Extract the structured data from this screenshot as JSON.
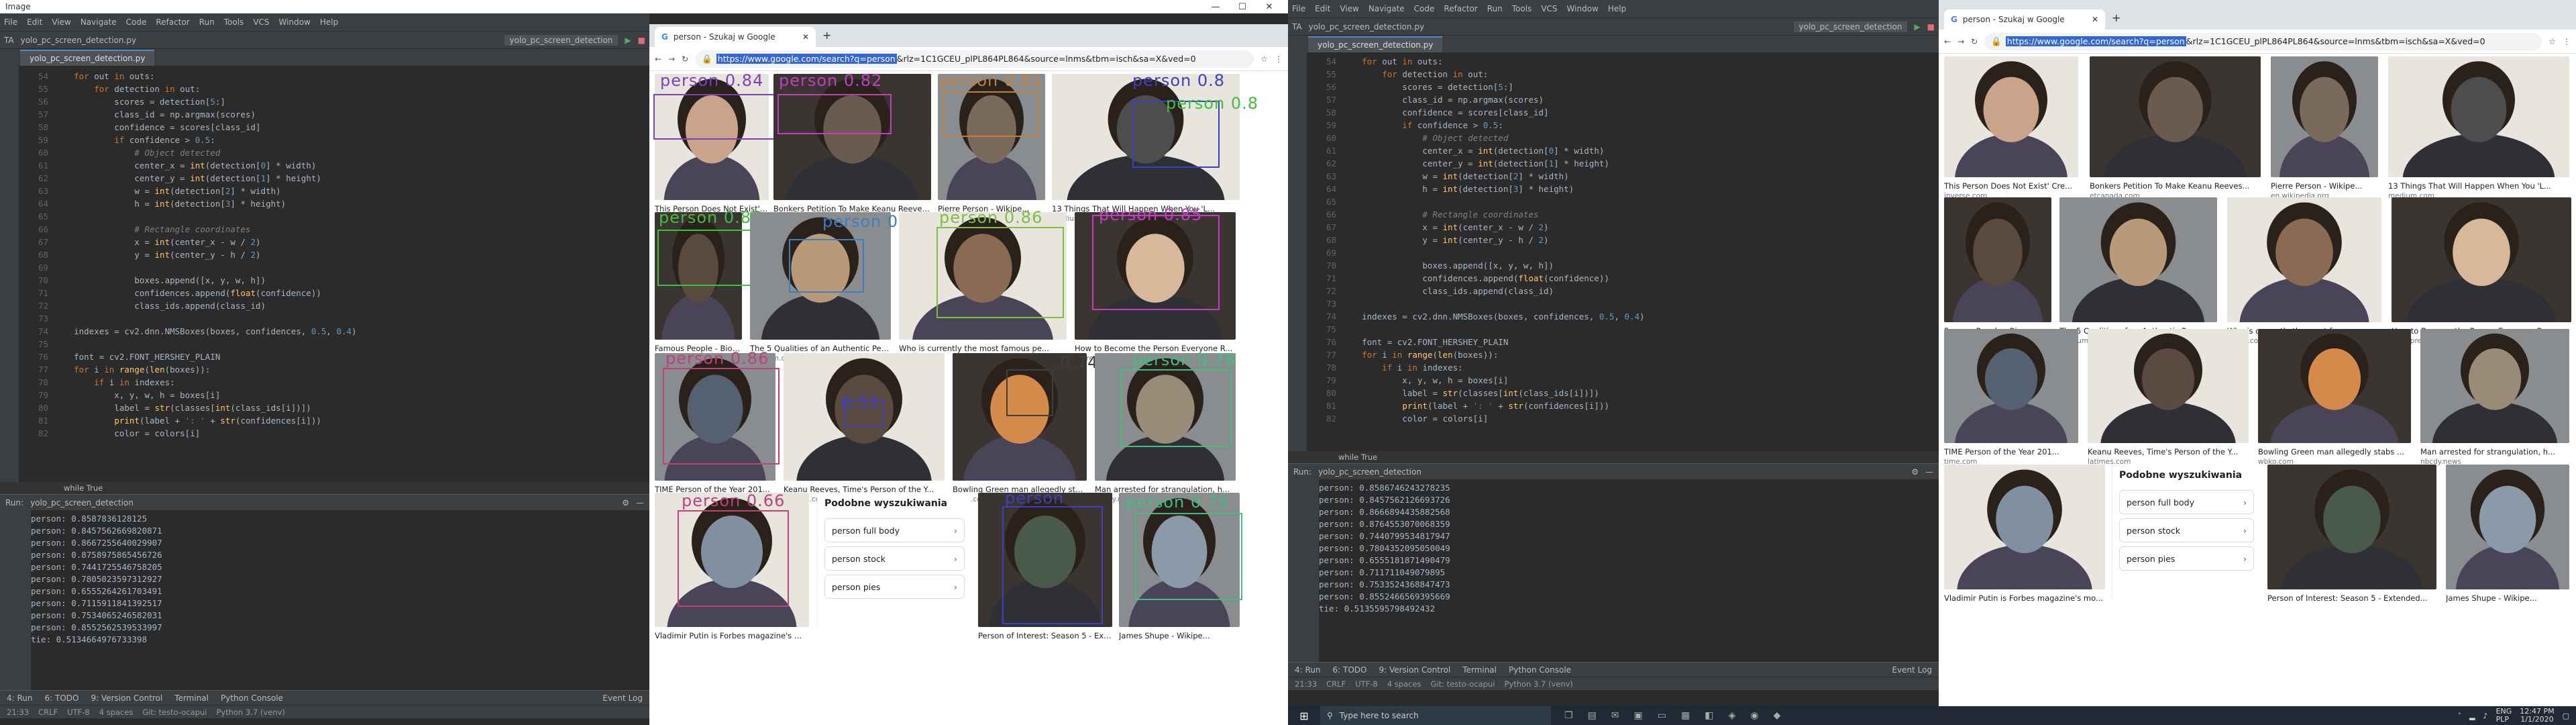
{
  "image_window": {
    "title": "Image",
    "controls": [
      "—",
      "☐",
      "✕"
    ]
  },
  "ide": {
    "menu": [
      "File",
      "Edit",
      "View",
      "Navigate",
      "Code",
      "Refactor",
      "Run",
      "Tools",
      "VCS",
      "Window",
      "Help"
    ],
    "project": "TA",
    "file": "yolo_pc_screen_detection.py",
    "run_config": "yolo_pc_screen_detection",
    "tab_label": "yolo_pc_screen_detection.py",
    "breadcrumb": "while True",
    "run_label": "Run:",
    "run_config_tab": "yolo_pc_screen_detection",
    "bottom_tabs": [
      "4: Run",
      "6: TODO",
      "9: Version Control",
      "Terminal",
      "Python Console"
    ],
    "event_log": "Event Log",
    "status": [
      "21:33",
      "CRLF",
      "UTF-8",
      "4 spaces",
      "Git: testo-ocapui",
      "Python 3.7 (venv)"
    ]
  },
  "code_left": [
    {
      "n": "54",
      "t": "    for out in outs:"
    },
    {
      "n": "55",
      "t": "        for detection in out:"
    },
    {
      "n": "56",
      "t": "            scores = detection[5:]"
    },
    {
      "n": "57",
      "t": "            class_id = np.argmax(scores)"
    },
    {
      "n": "58",
      "t": "            confidence = scores[class_id]"
    },
    {
      "n": "59",
      "t": "            if confidence > 0.5:"
    },
    {
      "n": "60",
      "t": "                # Object detected"
    },
    {
      "n": "61",
      "t": "                center_x = int(detection[0] * width)"
    },
    {
      "n": "62",
      "t": "                center_y = int(detection[1] * height)"
    },
    {
      "n": "63",
      "t": "                w = int(detection[2] * width)"
    },
    {
      "n": "64",
      "t": "                h = int(detection[3] * height)"
    },
    {
      "n": "65",
      "t": ""
    },
    {
      "n": "66",
      "t": "                # Rectangle coordinates"
    },
    {
      "n": "67",
      "t": "                x = int(center_x - w / 2)"
    },
    {
      "n": "68",
      "t": "                y = int(center_y - h / 2)"
    },
    {
      "n": "69",
      "t": ""
    },
    {
      "n": "70",
      "t": "                boxes.append([x, y, w, h])"
    },
    {
      "n": "71",
      "t": "                confidences.append(float(confidence))"
    },
    {
      "n": "72",
      "t": "                class_ids.append(class_id)"
    },
    {
      "n": "73",
      "t": ""
    },
    {
      "n": "74",
      "t": "    indexes = cv2.dnn.NMSBoxes(boxes, confidences, 0.5, 0.4)"
    },
    {
      "n": "75",
      "t": ""
    },
    {
      "n": "76",
      "t": "    font = cv2.FONT_HERSHEY_PLAIN"
    },
    {
      "n": "77",
      "t": "    for i in range(len(boxes)):"
    },
    {
      "n": "78",
      "t": "        if i in indexes:"
    },
    {
      "n": "79",
      "t": "            x, y, w, h = boxes[i]"
    },
    {
      "n": "80",
      "t": "            label = str(classes[int(class_ids[i])])"
    },
    {
      "n": "81",
      "t": "            print(label + ': ' + str(confidences[i]))"
    },
    {
      "n": "82",
      "t": "            color = colors[i]"
    }
  ],
  "code_right": [
    {
      "n": "54",
      "t": "    for out in outs:"
    },
    {
      "n": "55",
      "t": "        for detection in out:"
    },
    {
      "n": "56",
      "t": "            scores = detection[5:]"
    },
    {
      "n": "57",
      "t": "            class_id = np.argmax(scores)"
    },
    {
      "n": "58",
      "t": "            confidence = scores[class_id]"
    },
    {
      "n": "59",
      "t": "            if confidence > 0.5:"
    },
    {
      "n": "60",
      "t": "                # Object detected"
    },
    {
      "n": "61",
      "t": "                center_x = int(detection[0] * width)"
    },
    {
      "n": "62",
      "t": "                center_y = int(detection[1] * height)"
    },
    {
      "n": "63",
      "t": "                w = int(detection[2] * width)"
    },
    {
      "n": "64",
      "t": "                h = int(detection[3] * height)"
    },
    {
      "n": "65",
      "t": ""
    },
    {
      "n": "66",
      "t": "                # Rectangle coordinates"
    },
    {
      "n": "67",
      "t": "                x = int(center_x - w / 2)"
    },
    {
      "n": "68",
      "t": "                y = int(center_y - h / 2)"
    },
    {
      "n": "69",
      "t": ""
    },
    {
      "n": "70",
      "t": "                boxes.append([x, y, w, h])"
    },
    {
      "n": "71",
      "t": "                confidences.append(float(confidence))"
    },
    {
      "n": "72",
      "t": "                class_ids.append(class_id)"
    },
    {
      "n": "73",
      "t": ""
    },
    {
      "n": "74",
      "t": "    indexes = cv2.dnn.NMSBoxes(boxes, confidences, 0.5, 0.4)"
    },
    {
      "n": "75",
      "t": ""
    },
    {
      "n": "76",
      "t": "    font = cv2.FONT_HERSHEY_PLAIN"
    },
    {
      "n": "77",
      "t": "    for i in range(len(boxes)):"
    },
    {
      "n": "78",
      "t": "        if i in indexes:"
    },
    {
      "n": "79",
      "t": "            x, y, w, h = boxes[i]"
    },
    {
      "n": "80",
      "t": "            label = str(classes[int(class_ids[i])])"
    },
    {
      "n": "81",
      "t": "            print(label + ': ' + str(confidences[i]))"
    },
    {
      "n": "82",
      "t": "            color = colors[i]"
    }
  ],
  "console_left": [
    "person: 0.8587836128125",
    "person: 0.8457562669820871",
    "person: 0.8667255640029907",
    "person: 0.8758975865456726",
    "person: 0.7441725546758205",
    "person: 0.7805023597312927",
    "person: 0.6555264261703491",
    "person: 0.7115911841392517",
    "person: 0.7534065246582031",
    "person: 0.8552562539533997",
    "tie: 0.5134664976733398"
  ],
  "console_right": [
    "person: 0.8586746243278235",
    "person: 0.8457562126693726",
    "person: 0.8666894435882568",
    "person: 0.8764553070068359",
    "person: 0.7440799534817947",
    "person: 0.7804352095050049",
    "person: 0.6555181871490479",
    "person: 0.711711049079895",
    "person: 0.7533524368847473",
    "person: 0.8552466569395669",
    "tie: 0.5135595798492432"
  ],
  "browser": {
    "tab_title": "person - Szukaj w Google",
    "new_tab": "+",
    "url_selected": "https://www.google.com/search?q=person",
    "url_rest": "&rlz=1C1GCEU_plPL864PL864&source=lnms&tbm=isch&sa=X&ved=0"
  },
  "results": [
    {
      "title": "This Person Does Not Exist' Cre...",
      "source": "inverse.com"
    },
    {
      "title": "Bonkers Petition To Make Keanu Reeves...",
      "source": "etcanada.com"
    },
    {
      "title": "Pierre Person - Wikipe...",
      "source": "en.wikipedia.org"
    },
    {
      "title": "13 Things That Will Happen When You 'L...",
      "source": "medium.com"
    },
    {
      "title": "Famous People - Biog...",
      "source": "biography.com"
    },
    {
      "title": "The 5 Qualities of an Authentic Perso...",
      "source": "medium.com"
    },
    {
      "title": "Who is currently the most famous pe...",
      "source": "quora.com"
    },
    {
      "title": "How to Become the Person Everyone R...",
      "source": "entrepreneur.com"
    },
    {
      "title": "TIME Person of the Year 201...",
      "source": "time.com"
    },
    {
      "title": "Keanu Reeves, Time's Person of the Y...",
      "source": "latimes.com"
    },
    {
      "title": "Bowling Green man allegedly stabs ...",
      "source": "wbko.com"
    },
    {
      "title": "Man arrested for strangulation, h...",
      "source": "nbcdy.news"
    },
    {
      "title": "Vladimir Putin is Forbes magazine's mo...",
      "source": ""
    },
    {
      "title": "Person of Interest: Season 5 - Extended...",
      "source": ""
    },
    {
      "title": "James Shupe - Wikipe...",
      "source": ""
    }
  ],
  "related": {
    "title": "Podobne wyszukiwania",
    "items": [
      "person full body",
      "person stock",
      "person pies"
    ]
  },
  "detections": [
    {
      "label": "person 0.84",
      "color": "#7f3fbf"
    },
    {
      "label": "person 0.82",
      "color": "#bf3fbf"
    },
    {
      "label": "person 0.81",
      "color": "#bf7f3f"
    },
    {
      "label": "person 0.8",
      "color": "#3f3fbf"
    },
    {
      "label": "person 0.87",
      "color": "#3fbf3f"
    },
    {
      "label": "person 0.87",
      "color": "#3f7fbf"
    },
    {
      "label": "person 0.86",
      "color": "#7fbf3f"
    },
    {
      "label": "person 0.85",
      "color": "#bf3fbf"
    },
    {
      "label": "person 0.86",
      "color": "#bf3f7f"
    },
    {
      "label": "0.51",
      "color": "#3f3fbf"
    },
    {
      "label": "0.74",
      "color": "#3f3f3f"
    },
    {
      "label": "person 0.78",
      "color": "#3fbf7f"
    },
    {
      "label": "person 0.66",
      "color": "#bf3f7f"
    },
    {
      "label": "person",
      "color": "#3f3fbf"
    },
    {
      "label": "person 0.75",
      "color": "#3fbf7f"
    },
    {
      "label": "person 0.8",
      "color": "#3fbf3f"
    }
  ],
  "taskbar": {
    "search_placeholder": "Type here to search",
    "time": "12:47 PM",
    "date": "1/1/2020",
    "lang": "ENG\nPLP"
  }
}
